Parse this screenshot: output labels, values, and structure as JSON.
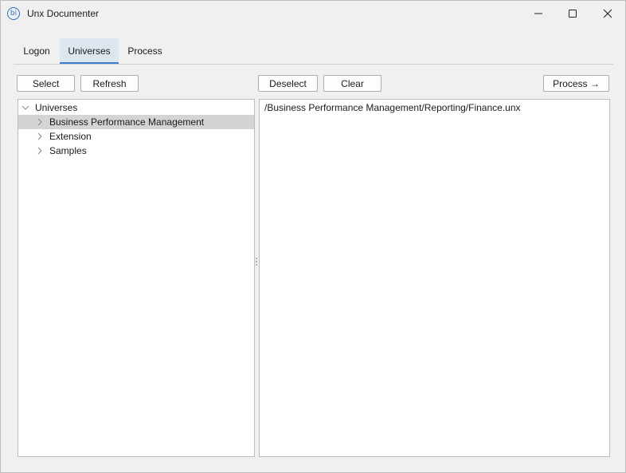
{
  "window": {
    "title": "Unx Documenter",
    "icon_text": "bi"
  },
  "tabs": [
    {
      "label": "Logon"
    },
    {
      "label": "Universes",
      "active": true
    },
    {
      "label": "Process"
    }
  ],
  "toolbar": {
    "select_label": "Select",
    "refresh_label": "Refresh",
    "deselect_label": "Deselect",
    "clear_label": "Clear",
    "process_label": "Process →"
  },
  "tree": {
    "root": "Universes",
    "items": [
      {
        "label": "Business Performance Management",
        "selected": true
      },
      {
        "label": "Extension"
      },
      {
        "label": "Samples"
      }
    ]
  },
  "selected_paths": [
    "/Business Performance Management/Reporting/Finance.unx"
  ],
  "colors": {
    "accent": "#3b7ccf",
    "active_tab_bg": "#dde6ee",
    "selected_row_bg": "#d4d4d4"
  }
}
